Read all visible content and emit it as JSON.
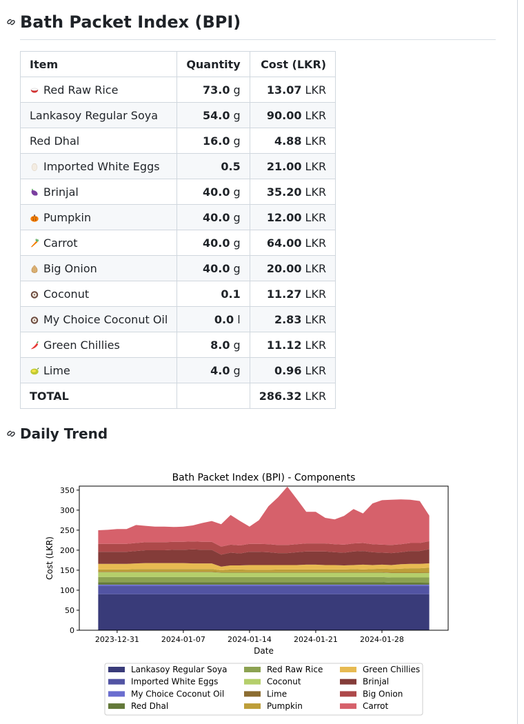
{
  "heading_bpi": "Bath Packet Index (BPI)",
  "heading_trend": "Daily Trend",
  "table": {
    "headers": [
      "Item",
      "Quantity",
      "Cost (LKR)"
    ],
    "rows": [
      {
        "icon": "rice-bowl-icon",
        "name": "Red Raw Rice",
        "qty": "73.0",
        "unit": "g",
        "cost": "13.07",
        "currency": "LKR"
      },
      {
        "icon": "",
        "name": "Lankasoy Regular Soya",
        "qty": "54.0",
        "unit": "g",
        "cost": "90.00",
        "currency": "LKR"
      },
      {
        "icon": "",
        "name": "Red Dhal",
        "qty": "16.0",
        "unit": "g",
        "cost": "4.88",
        "currency": "LKR"
      },
      {
        "icon": "egg-icon",
        "name": "Imported White Eggs",
        "qty": "0.5",
        "unit": "",
        "cost": "21.00",
        "currency": "LKR"
      },
      {
        "icon": "eggplant-icon",
        "name": "Brinjal",
        "qty": "40.0",
        "unit": "g",
        "cost": "35.20",
        "currency": "LKR"
      },
      {
        "icon": "pumpkin-icon",
        "name": "Pumpkin",
        "qty": "40.0",
        "unit": "g",
        "cost": "12.00",
        "currency": "LKR"
      },
      {
        "icon": "carrot-icon",
        "name": "Carrot",
        "qty": "40.0",
        "unit": "g",
        "cost": "64.00",
        "currency": "LKR"
      },
      {
        "icon": "onion-icon",
        "name": "Big Onion",
        "qty": "40.0",
        "unit": "g",
        "cost": "20.00",
        "currency": "LKR"
      },
      {
        "icon": "coconut-icon",
        "name": "Coconut",
        "qty": "0.1",
        "unit": "",
        "cost": "11.27",
        "currency": "LKR"
      },
      {
        "icon": "coconut-icon",
        "name": "My Choice Coconut Oil",
        "qty": "0.0",
        "unit": "l",
        "cost": "2.83",
        "currency": "LKR"
      },
      {
        "icon": "chili-icon",
        "name": "Green Chillies",
        "qty": "8.0",
        "unit": "g",
        "cost": "11.12",
        "currency": "LKR"
      },
      {
        "icon": "lime-icon",
        "name": "Lime",
        "qty": "4.0",
        "unit": "g",
        "cost": "0.96",
        "currency": "LKR"
      }
    ],
    "total": {
      "label": "TOTAL",
      "cost": "286.32",
      "currency": "LKR"
    }
  },
  "chart_data": {
    "type": "area",
    "stacked": true,
    "title": "Bath Packet Index (BPI) - Components",
    "xlabel": "Date",
    "ylabel": "Cost (LKR)",
    "ylim": [
      0,
      360
    ],
    "yticks": [
      0,
      50,
      100,
      150,
      200,
      250,
      300,
      350
    ],
    "xticks": [
      "2023-12-31",
      "2024-01-07",
      "2024-01-14",
      "2024-01-21",
      "2024-01-28"
    ],
    "legend_position": "bottom",
    "x": [
      "2023-12-29",
      "2023-12-30",
      "2023-12-31",
      "2024-01-01",
      "2024-01-02",
      "2024-01-03",
      "2024-01-04",
      "2024-01-05",
      "2024-01-06",
      "2024-01-07",
      "2024-01-08",
      "2024-01-09",
      "2024-01-10",
      "2024-01-11",
      "2024-01-12",
      "2024-01-13",
      "2024-01-14",
      "2024-01-15",
      "2024-01-16",
      "2024-01-17",
      "2024-01-18",
      "2024-01-19",
      "2024-01-20",
      "2024-01-21",
      "2024-01-22",
      "2024-01-23",
      "2024-01-24",
      "2024-01-25",
      "2024-01-26",
      "2024-01-27",
      "2024-01-28",
      "2024-01-29",
      "2024-01-30",
      "2024-01-31",
      "2024-02-01",
      "2024-02-02"
    ],
    "series": [
      {
        "name": "Lankasoy Regular Soya",
        "color": "#393b79",
        "values": [
          90,
          90,
          90,
          90,
          90,
          90,
          90,
          90,
          90,
          90,
          90,
          90,
          90,
          90,
          90,
          90,
          90,
          90,
          90,
          90,
          90,
          90,
          90,
          90,
          90,
          90,
          90,
          90,
          90,
          90,
          90,
          90,
          90,
          90,
          90,
          90
        ]
      },
      {
        "name": "Imported White Eggs",
        "color": "#5254a3",
        "values": [
          21,
          21,
          21,
          21,
          21,
          21,
          21,
          21,
          21,
          21,
          21,
          21,
          21,
          21,
          21,
          21,
          21,
          21,
          21,
          21,
          21,
          21,
          21,
          21,
          21,
          21,
          21,
          21,
          21,
          21,
          21,
          21,
          21,
          21,
          21,
          21
        ]
      },
      {
        "name": "My Choice Coconut Oil",
        "color": "#6b6ecf",
        "values": [
          2.83,
          2.83,
          2.83,
          2.83,
          2.83,
          2.83,
          2.83,
          2.83,
          2.83,
          2.83,
          2.83,
          2.83,
          2.83,
          2.83,
          2.83,
          2.83,
          2.83,
          2.83,
          2.83,
          2.83,
          2.83,
          2.83,
          2.83,
          2.83,
          2.83,
          2.83,
          2.83,
          2.83,
          2.83,
          2.83,
          2.83,
          2.83,
          2.83,
          2.83,
          2.83,
          2.83
        ]
      },
      {
        "name": "Red Dhal",
        "color": "#637939",
        "values": [
          6,
          6,
          6,
          6,
          6,
          6,
          6,
          6,
          6,
          6,
          6,
          6,
          6,
          6,
          6,
          6,
          6,
          6,
          6,
          6,
          6,
          6,
          6,
          6,
          6,
          6,
          6,
          6,
          6,
          6,
          6,
          5,
          5,
          5,
          5,
          4.88
        ]
      },
      {
        "name": "Red Raw Rice",
        "color": "#8ca252",
        "values": [
          13,
          13,
          13,
          13,
          13,
          13,
          13,
          13,
          13,
          13,
          13,
          13,
          13,
          13,
          13,
          13,
          13,
          13,
          13,
          13,
          13,
          13,
          13,
          13,
          13,
          13,
          13,
          13,
          13,
          13,
          13,
          13,
          13,
          13,
          13,
          13.07
        ]
      },
      {
        "name": "Coconut",
        "color": "#b5cf6b",
        "values": [
          12,
          12,
          12,
          12,
          12,
          12,
          12,
          12,
          12,
          12,
          12,
          12,
          12,
          11,
          11,
          11,
          11,
          11,
          11,
          11,
          11,
          11,
          11,
          11,
          11,
          11,
          11,
          11,
          11,
          11,
          11,
          11,
          11,
          11,
          11,
          11.27
        ]
      },
      {
        "name": "Lime",
        "color": "#8c6d31",
        "values": [
          1,
          1,
          1,
          1,
          1,
          1,
          1,
          1,
          1,
          1,
          1,
          1,
          1,
          1,
          1,
          1,
          1,
          1,
          1,
          1,
          1,
          1,
          1,
          1,
          1,
          1,
          1,
          1,
          1,
          1,
          1,
          1,
          1,
          1,
          1,
          0.96
        ]
      },
      {
        "name": "Pumpkin",
        "color": "#bd9e39",
        "values": [
          6,
          6,
          6,
          6,
          7,
          7,
          7,
          7,
          7,
          7,
          7,
          7,
          7,
          5,
          7,
          7,
          6,
          6,
          6,
          7,
          7,
          7,
          7,
          7,
          7,
          7,
          7,
          8,
          7,
          8,
          9,
          9,
          10,
          11,
          11,
          12
        ]
      },
      {
        "name": "Green Chillies",
        "color": "#e7ba52",
        "values": [
          14,
          14,
          14,
          14,
          14,
          15,
          15,
          15,
          15,
          15,
          14,
          14,
          14,
          9,
          10,
          10,
          12,
          12,
          12,
          11,
          11,
          11,
          12,
          12,
          11,
          11,
          10,
          10,
          12,
          10,
          10,
          10,
          11,
          11,
          11,
          11.12
        ]
      },
      {
        "name": "Brinjal",
        "color": "#843c39",
        "values": [
          30,
          30,
          30,
          30,
          31,
          32,
          32,
          32,
          33,
          33,
          35,
          34,
          34,
          30,
          32,
          30,
          33,
          33,
          32,
          30,
          30,
          32,
          33,
          33,
          34,
          32,
          32,
          34,
          34,
          32,
          30,
          30,
          30,
          32,
          32,
          35.2
        ]
      },
      {
        "name": "Big Onion",
        "color": "#ad494a",
        "values": [
          20,
          20,
          20,
          20,
          20,
          20,
          20,
          20,
          20,
          20,
          20,
          20,
          20,
          20,
          20,
          20,
          20,
          20,
          20,
          20,
          20,
          20,
          20,
          20,
          20,
          20,
          20,
          20,
          20,
          20,
          20,
          20,
          20,
          20,
          20,
          20
        ]
      },
      {
        "name": "Carrot",
        "color": "#d6616b",
        "values": [
          34,
          35,
          37,
          37,
          45,
          41,
          39,
          39,
          37,
          38,
          40,
          47,
          52,
          56,
          74,
          61,
          43,
          59,
          95,
          119,
          146,
          113,
          79,
          79,
          64,
          62,
          72,
          86,
          74,
          102,
          111,
          113,
          112,
          108,
          105,
          64
        ]
      }
    ]
  }
}
